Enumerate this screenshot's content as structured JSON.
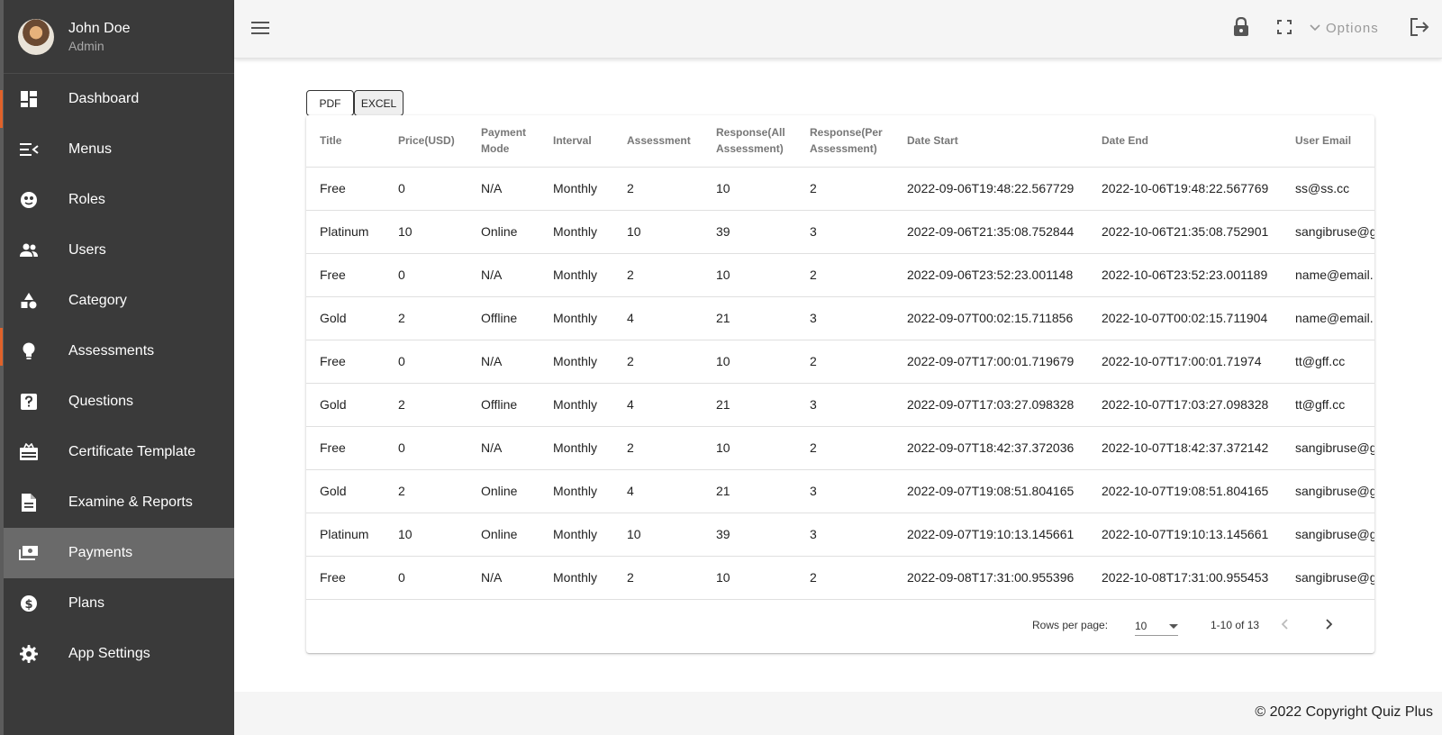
{
  "user": {
    "name": "John Doe",
    "role": "Admin"
  },
  "sidebar": {
    "items": [
      {
        "label": "Dashboard",
        "icon": "dashboard-icon"
      },
      {
        "label": "Menus",
        "icon": "menu-open-icon"
      },
      {
        "label": "Roles",
        "icon": "roles-icon"
      },
      {
        "label": "Users",
        "icon": "users-icon"
      },
      {
        "label": "Category",
        "icon": "category-icon"
      },
      {
        "label": "Assessments",
        "icon": "lightbulb-icon"
      },
      {
        "label": "Questions",
        "icon": "question-icon"
      },
      {
        "label": "Certificate Template",
        "icon": "certificate-icon"
      },
      {
        "label": "Examine & Reports",
        "icon": "report-icon"
      },
      {
        "label": "Payments",
        "icon": "payments-icon",
        "active": true
      },
      {
        "label": "Plans",
        "icon": "dollar-icon"
      },
      {
        "label": "App Settings",
        "icon": "gear-icon"
      }
    ]
  },
  "header": {
    "options_label": "Options"
  },
  "export": {
    "pdf_label": "PDF",
    "excel_label": "EXCEL"
  },
  "table": {
    "columns": [
      "Title",
      "Price(USD)",
      "Payment Mode",
      "Interval",
      "Assessment",
      "Response(All Assessment)",
      "Response(Per Assessment)",
      "Date Start",
      "Date End",
      "User Email"
    ],
    "rows": [
      [
        "Free",
        "0",
        "N/A",
        "Monthly",
        "2",
        "10",
        "2",
        "2022-09-06T19:48:22.567729",
        "2022-10-06T19:48:22.567769",
        "ss@ss.cc"
      ],
      [
        "Platinum",
        "10",
        "Online",
        "Monthly",
        "10",
        "39",
        "3",
        "2022-09-06T21:35:08.752844",
        "2022-10-06T21:35:08.752901",
        "sangibruse@g"
      ],
      [
        "Free",
        "0",
        "N/A",
        "Monthly",
        "2",
        "10",
        "2",
        "2022-09-06T23:52:23.001148",
        "2022-10-06T23:52:23.001189",
        "name@email."
      ],
      [
        "Gold",
        "2",
        "Offline",
        "Monthly",
        "4",
        "21",
        "3",
        "2022-09-07T00:02:15.711856",
        "2022-10-07T00:02:15.711904",
        "name@email."
      ],
      [
        "Free",
        "0",
        "N/A",
        "Monthly",
        "2",
        "10",
        "2",
        "2022-09-07T17:00:01.719679",
        "2022-10-07T17:00:01.71974",
        "tt@gff.cc"
      ],
      [
        "Gold",
        "2",
        "Offline",
        "Monthly",
        "4",
        "21",
        "3",
        "2022-09-07T17:03:27.098328",
        "2022-10-07T17:03:27.098328",
        "tt@gff.cc"
      ],
      [
        "Free",
        "0",
        "N/A",
        "Monthly",
        "2",
        "10",
        "2",
        "2022-09-07T18:42:37.372036",
        "2022-10-07T18:42:37.372142",
        "sangibruse@g"
      ],
      [
        "Gold",
        "2",
        "Online",
        "Monthly",
        "4",
        "21",
        "3",
        "2022-09-07T19:08:51.804165",
        "2022-10-07T19:08:51.804165",
        "sangibruse@g"
      ],
      [
        "Platinum",
        "10",
        "Online",
        "Monthly",
        "10",
        "39",
        "3",
        "2022-09-07T19:10:13.145661",
        "2022-10-07T19:10:13.145661",
        "sangibruse@g"
      ],
      [
        "Free",
        "0",
        "N/A",
        "Monthly",
        "2",
        "10",
        "2",
        "2022-09-08T17:31:00.955396",
        "2022-10-08T17:31:00.955453",
        "sangibruse@g"
      ]
    ]
  },
  "pagination": {
    "rows_label": "Rows per page:",
    "rows_value": "10",
    "range": "1-10 of 13"
  },
  "footer": {
    "copyright": "© 2022 Copyright Quiz Plus"
  },
  "colors": {
    "sidebar_bg": "#3a3a3a",
    "active_item": "#6a6a6a",
    "accent": "#e0622a"
  }
}
